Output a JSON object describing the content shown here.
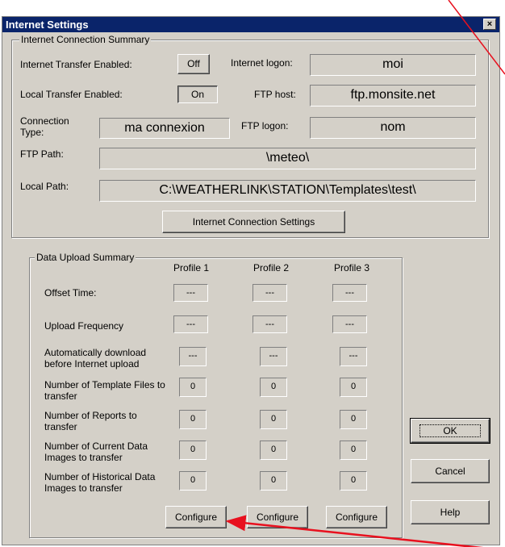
{
  "window": {
    "title": "Internet Settings",
    "close": "×"
  },
  "connection": {
    "group_title": "Internet Connection Summary",
    "internet_transfer_label": "Internet Transfer Enabled:",
    "internet_transfer_value": "Off",
    "local_transfer_label": "Local Transfer Enabled:",
    "local_transfer_value": "On",
    "connection_type_label": "Connection Type:",
    "connection_type_value": "ma connexion",
    "internet_logon_label": "Internet logon:",
    "internet_logon_value": "moi",
    "ftp_host_label": "FTP host:",
    "ftp_host_value": "ftp.monsite.net",
    "ftp_logon_label": "FTP logon:",
    "ftp_logon_value": "nom",
    "ftp_path_label": "FTP Path:",
    "ftp_path_value": "\\meteo\\",
    "local_path_label": "Local Path:",
    "local_path_value": "C:\\WEATHERLINK\\STATION\\Templates\\test\\",
    "settings_button": "Internet Connection Settings"
  },
  "upload": {
    "group_title": "Data Upload Summary",
    "profiles": [
      "Profile 1",
      "Profile 2",
      "Profile 3"
    ],
    "rows": [
      {
        "label": "Offset Time:",
        "values": [
          "---",
          "---",
          "---"
        ]
      },
      {
        "label": "Upload Frequency",
        "values": [
          "---",
          "---",
          "---"
        ]
      },
      {
        "label": "Automatically download before Internet upload",
        "values": [
          "---",
          "---",
          "---"
        ]
      },
      {
        "label": "Number of Template Files to transfer",
        "values": [
          "0",
          "0",
          "0"
        ]
      },
      {
        "label": "Number of Reports to transfer",
        "values": [
          "0",
          "0",
          "0"
        ]
      },
      {
        "label": "Number of Current Data Images to transfer",
        "values": [
          "0",
          "0",
          "0"
        ]
      },
      {
        "label": "Number of Historical Data Images to transfer",
        "values": [
          "0",
          "0",
          "0"
        ]
      }
    ],
    "configure_label": "Configure"
  },
  "buttons": {
    "ok": "OK",
    "cancel": "Cancel",
    "help": "Help"
  },
  "colors": {
    "titlebar": "#0a246a",
    "annotation_arrow": "#e8101e",
    "dialog_bg": "#d4d0c8"
  }
}
